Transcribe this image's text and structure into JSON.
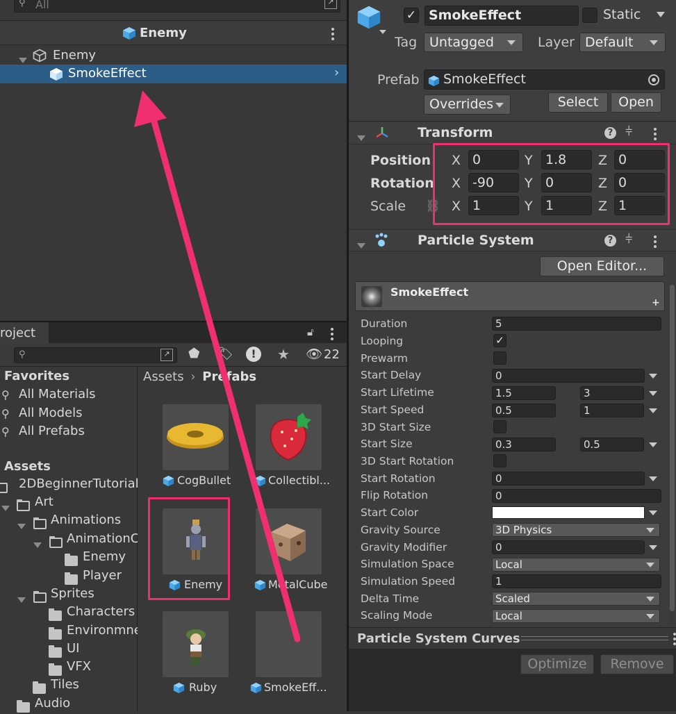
{
  "hierarchy": {
    "search_placeholder": "All",
    "scene_title": "Enemy",
    "tree": [
      {
        "label": "Enemy",
        "expanded": true
      },
      {
        "label": "SmokeEffect",
        "selected": true
      }
    ]
  },
  "project": {
    "tab_label": "roject",
    "hidden_count": "22",
    "breadcrumb_root": "Assets",
    "breadcrumb_current": "Prefabs",
    "favorites_header": "Favorites",
    "favorites": [
      "All Materials",
      "All Models",
      "All Prefabs"
    ],
    "assets_header": "Assets",
    "folders": [
      "2DBeginnerTutorial",
      "Art",
      "Animations",
      "AnimationC",
      "Enemy",
      "Player",
      "Sprites",
      "Characters",
      "Environmne",
      "UI",
      "VFX",
      "Tiles",
      "Audio"
    ],
    "grid_items": [
      "CogBullet",
      "Collectibl...",
      "Enemy",
      "MetalCube",
      "Ruby",
      "SmokeEff..."
    ]
  },
  "inspector": {
    "object_name": "SmokeEffect",
    "static_label": "Static",
    "tag_label": "Tag",
    "tag_value": "Untagged",
    "layer_label": "Layer",
    "layer_value": "Default",
    "prefab_label": "Prefab",
    "prefab_value": "SmokeEffect",
    "overrides_label": "Overrides",
    "select_label": "Select",
    "open_label": "Open",
    "transform": {
      "title": "Transform",
      "position_label": "Position",
      "rotation_label": "Rotation",
      "scale_label": "Scale",
      "axis_x": "X",
      "axis_y": "Y",
      "axis_z": "Z",
      "position": {
        "x": "0",
        "y": "1.8",
        "z": "0"
      },
      "rotation": {
        "x": "-90",
        "y": "0",
        "z": "0"
      },
      "scale": {
        "x": "1",
        "y": "1",
        "z": "1"
      }
    },
    "particle_system": {
      "title": "Particle System",
      "open_editor_label": "Open Editor...",
      "module_title": "SmokeEffect",
      "rows": {
        "duration": {
          "label": "Duration",
          "value": "5"
        },
        "looping": {
          "label": "Looping",
          "checked": true
        },
        "prewarm": {
          "label": "Prewarm",
          "checked": false
        },
        "start_delay": {
          "label": "Start Delay",
          "value": "0"
        },
        "start_lifetime": {
          "label": "Start Lifetime",
          "min": "1.5",
          "max": "3"
        },
        "start_speed": {
          "label": "Start Speed",
          "min": "0.5",
          "max": "1"
        },
        "start_size_3d": {
          "label": "3D Start Size",
          "checked": false
        },
        "start_size": {
          "label": "Start Size",
          "min": "0.3",
          "max": "0.5"
        },
        "start_rotation_3d": {
          "label": "3D Start Rotation",
          "checked": false
        },
        "start_rotation": {
          "label": "Start Rotation",
          "value": "0"
        },
        "flip_rotation": {
          "label": "Flip Rotation",
          "value": "0"
        },
        "start_color": {
          "label": "Start Color",
          "color": "#ffffff"
        },
        "gravity_source": {
          "label": "Gravity Source",
          "value": "3D Physics"
        },
        "gravity_modifier": {
          "label": "Gravity Modifier",
          "value": "0"
        },
        "simulation_space": {
          "label": "Simulation Space",
          "value": "Local"
        },
        "simulation_speed": {
          "label": "Simulation Speed",
          "value": "1"
        },
        "delta_time": {
          "label": "Delta Time",
          "value": "Scaled"
        },
        "scaling_mode": {
          "label": "Scaling Mode",
          "value": "Local"
        }
      }
    },
    "curves_title": "Particle System Curves",
    "optimize_label": "Optimize",
    "remove_label": "Remove"
  },
  "colors": {
    "selection": "#2c5d87",
    "annotation": "#f0306e",
    "cube_icon": "#5ab4f0"
  }
}
